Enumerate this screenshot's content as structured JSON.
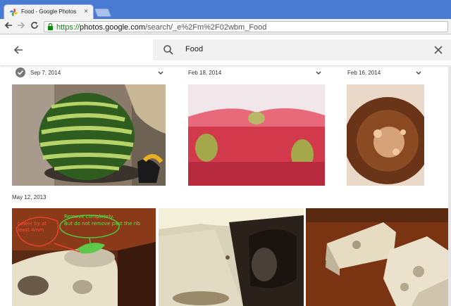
{
  "browser": {
    "tab_title": "Food - Google Photos",
    "tab_close": "×",
    "url_scheme": "https://",
    "url_host": "photos.google.com",
    "url_path": "/search/_e%2Fm%2F02wbm_Food"
  },
  "appbar": {
    "search_query": "Food"
  },
  "groups": [
    {
      "date": "Sep 7, 2014"
    },
    {
      "date": "Feb 18, 2014"
    },
    {
      "date": "Feb 16, 2014"
    },
    {
      "date": "May 12, 2013"
    }
  ],
  "annotations": {
    "red_note": "Lower by at\nleast 4mm",
    "green_note": "Remove completely.\nBut do not remove past the rib"
  },
  "colors": {
    "chrome_blue": "#4a7bd3",
    "url_green": "#0a8a0a",
    "search_bg": "#f1f1f1"
  }
}
